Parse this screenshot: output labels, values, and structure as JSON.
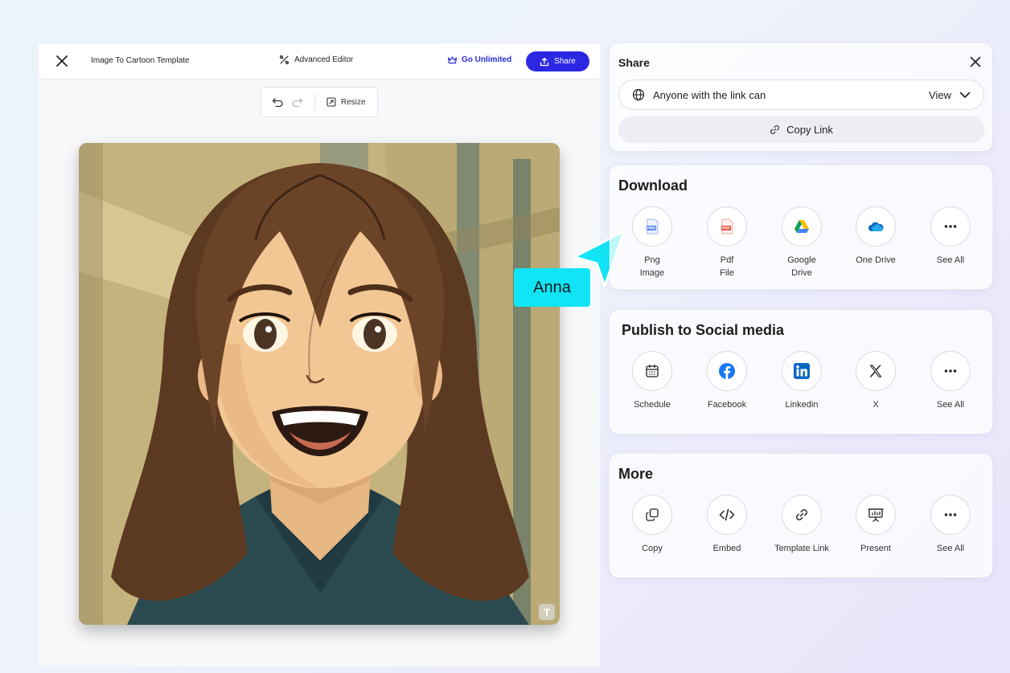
{
  "editor": {
    "title": "Image To Cartoon Template",
    "advanced_editor": "Advanced Editor",
    "go_unlimited": "Go Unlimited",
    "share": "Share",
    "resize": "Resize",
    "watermark": "T"
  },
  "cursor": {
    "name": "Anna",
    "color": "#11e5f5"
  },
  "share_panel": {
    "title": "Share",
    "access_text": "Anyone with the link can",
    "access_level": "View",
    "copy_link": "Copy Link"
  },
  "download": {
    "title": "Download",
    "items": [
      {
        "line1": "Png",
        "line2": "Image",
        "icon": "png-file-icon"
      },
      {
        "line1": "Pdf",
        "line2": "File",
        "icon": "pdf-file-icon"
      },
      {
        "line1": "Google",
        "line2": "Drive",
        "icon": "google-drive-icon"
      },
      {
        "line1": "One Drive",
        "line2": "",
        "icon": "onedrive-icon"
      },
      {
        "line1": "See All",
        "line2": "",
        "icon": "more-dots-icon"
      }
    ]
  },
  "social": {
    "title": "Publish to Social media",
    "items": [
      {
        "label": "Schedule",
        "icon": "calendar-icon"
      },
      {
        "label": "Facebook",
        "icon": "facebook-icon"
      },
      {
        "label": "Linkedin",
        "icon": "linkedin-icon"
      },
      {
        "label": "X",
        "icon": "x-icon"
      },
      {
        "label": "See All",
        "icon": "more-dots-icon"
      }
    ]
  },
  "more": {
    "title": "More",
    "items": [
      {
        "label": "Copy",
        "icon": "copy-icon"
      },
      {
        "label": "Embed",
        "icon": "embed-code-icon"
      },
      {
        "label": "Template Link",
        "icon": "link-icon"
      },
      {
        "label": "Present",
        "icon": "presentation-icon"
      },
      {
        "label": "See All",
        "icon": "more-dots-icon"
      }
    ]
  },
  "colors": {
    "accent": "#2b27e3",
    "facebook": "#1877f2",
    "linkedin": "#0a66c2"
  }
}
